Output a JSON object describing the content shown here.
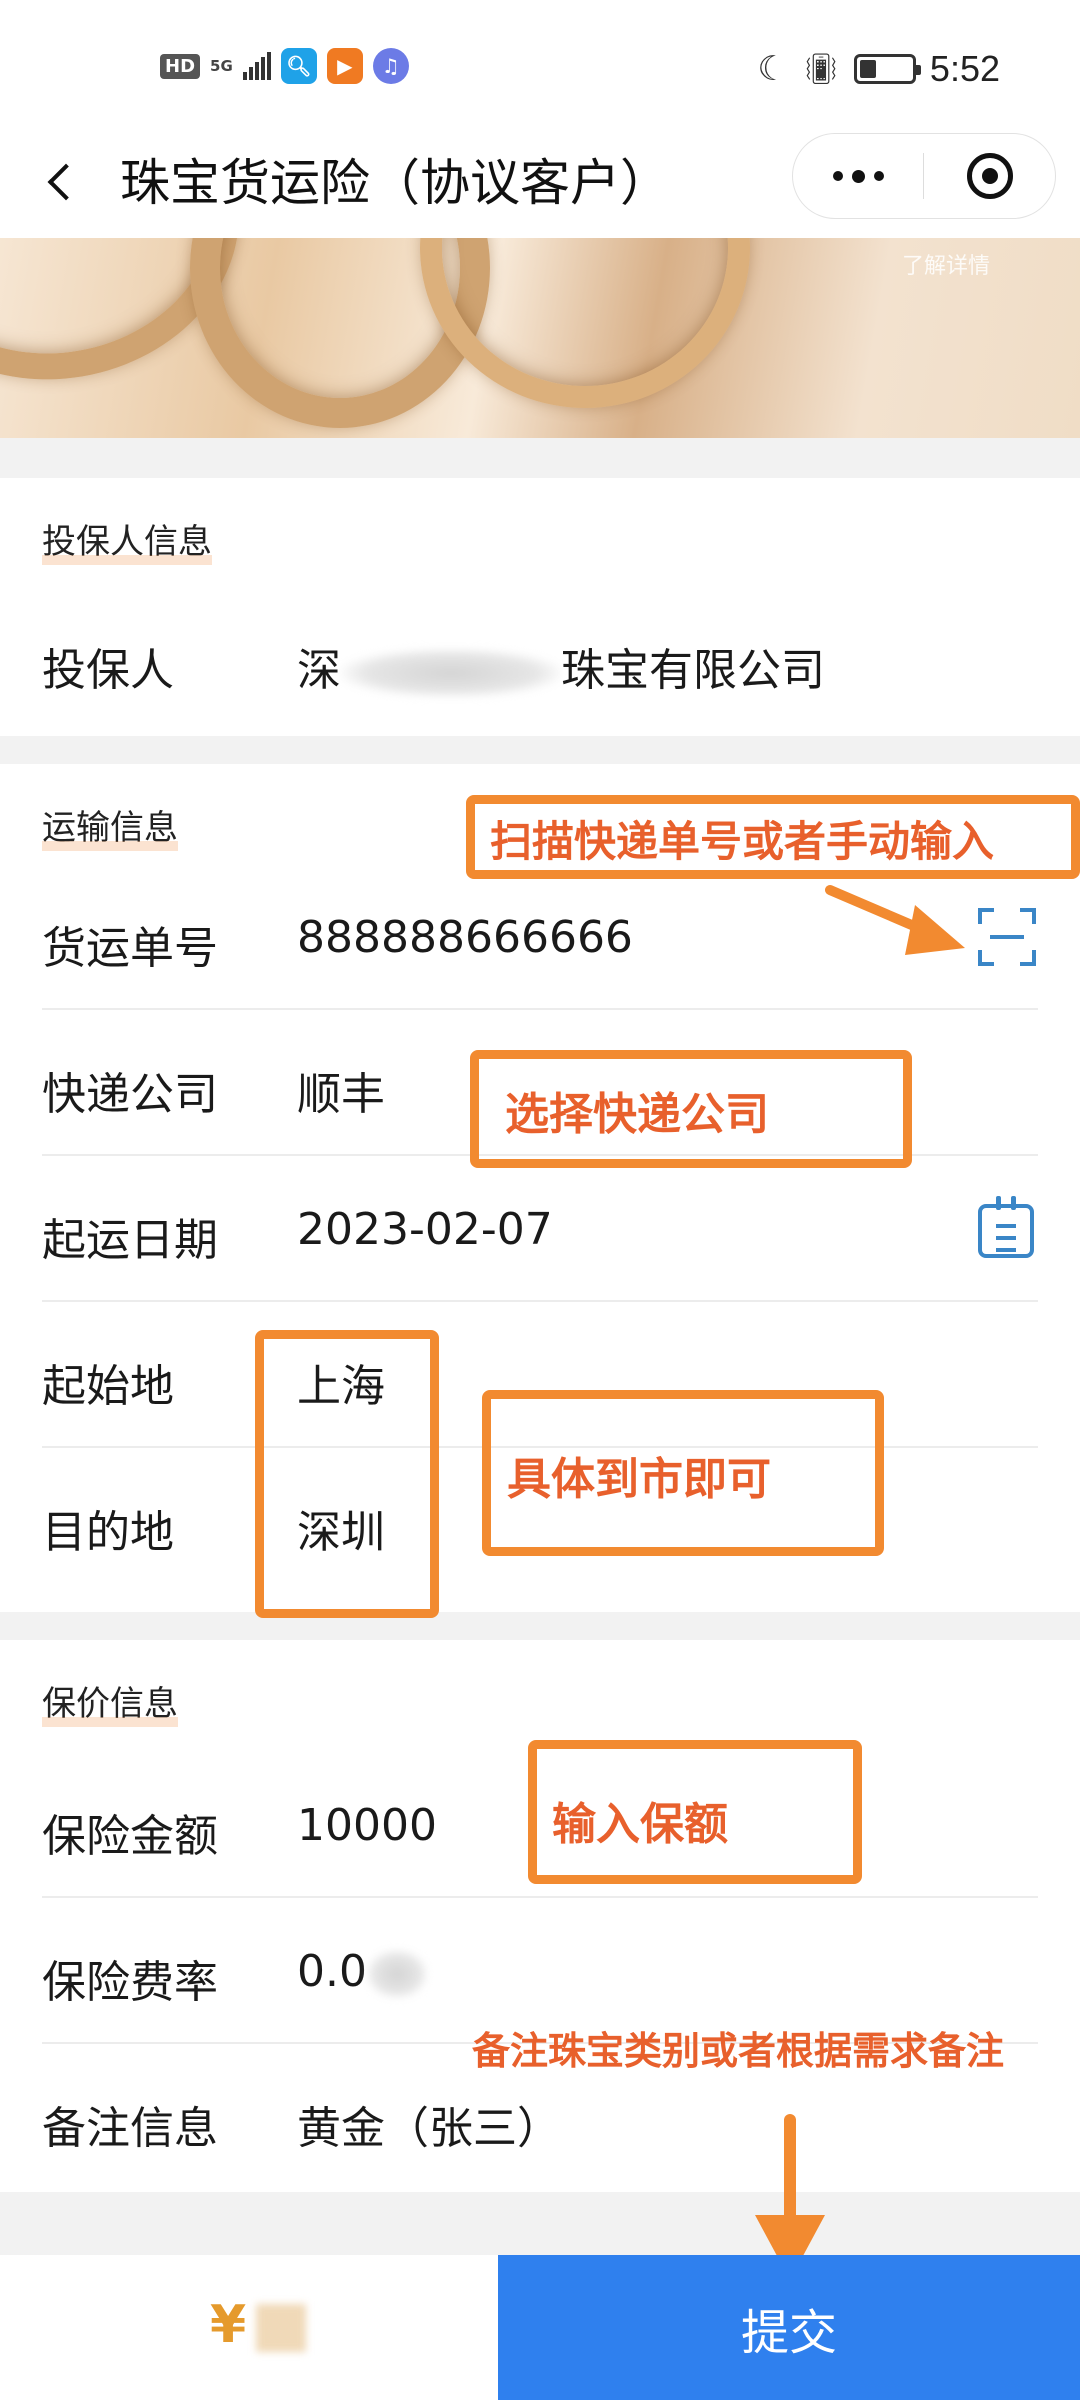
{
  "status_bar": {
    "hd": "HD",
    "network": "5G",
    "time": "5:52"
  },
  "header": {
    "title": "珠宝货运险（协议客户）",
    "back_icon": "chevron-left-icon",
    "more_icon": "more-dots-icon",
    "close_icon": "mini-program-close-icon"
  },
  "banner": {
    "tag": "了解详情"
  },
  "sections": {
    "applicant": {
      "heading": "投保人信息",
      "rows": [
        {
          "label": "投保人",
          "value_prefix": "深",
          "value_suffix": "珠宝有限公司"
        }
      ]
    },
    "transport": {
      "heading": "运输信息",
      "rows": [
        {
          "label": "货运单号",
          "value": "888888666666",
          "icon": "scan-icon"
        },
        {
          "label": "快递公司",
          "value": "顺丰"
        },
        {
          "label": "起运日期",
          "value": "2023-02-07",
          "icon": "calendar-icon"
        },
        {
          "label": "起始地",
          "value": "上海"
        },
        {
          "label": "目的地",
          "value": "深圳"
        }
      ]
    },
    "insured_value": {
      "heading": "保价信息",
      "rows": [
        {
          "label": "保险金额",
          "value": "10000"
        },
        {
          "label": "保险费率",
          "value": "0.0"
        },
        {
          "label": "备注信息",
          "value": "黄金（张三）"
        }
      ]
    }
  },
  "annotations": {
    "scan": "扫描快递单号或者手动输入",
    "courier": "选择快递公司",
    "city": "具体到市即可",
    "amount": "输入保额",
    "remark": "备注珠宝类别或者根据需求备注"
  },
  "footer": {
    "currency": "¥",
    "submit": "提交"
  },
  "colors": {
    "accent_blue": "#2f80ee",
    "annotation_orange": "#f28a30",
    "annotation_text": "#e8602c",
    "price": "#e59a2c"
  }
}
